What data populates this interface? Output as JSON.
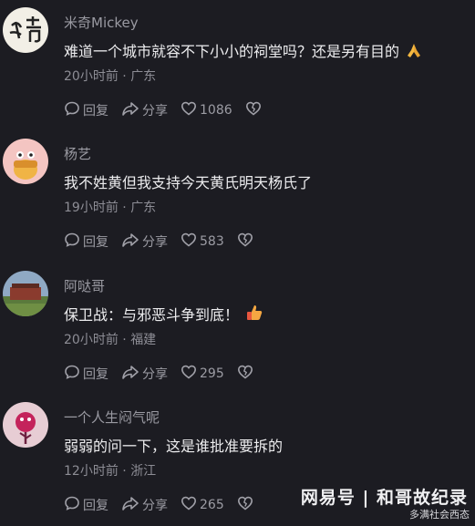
{
  "comments": [
    {
      "username": "米奇Mickey",
      "text": "难道一个城市就容不下小小的祠堂吗？还是另有目的",
      "emoji_icon": "praying-hands-icon",
      "time": "20小时前",
      "location": "广东",
      "reply_label": "回复",
      "share_label": "分享",
      "likes": "1086"
    },
    {
      "username": "杨艺",
      "text": "我不姓黄但我支持今天黄氏明天杨氏了",
      "time": "19小时前",
      "location": "广东",
      "reply_label": "回复",
      "share_label": "分享",
      "likes": "583"
    },
    {
      "username": "阿哒哥",
      "text": "保卫战：与邪恶斗争到底！",
      "emoji_icon": "thumbs-up-icon",
      "time": "20小时前",
      "location": "福建",
      "reply_label": "回复",
      "share_label": "分享",
      "likes": "295"
    },
    {
      "username": "一个人生闷气呢",
      "text": "弱弱的问一下，这是谁批准要拆的",
      "time": "12小时前",
      "location": "浙江",
      "reply_label": "回复",
      "share_label": "分享",
      "likes": "265"
    }
  ],
  "separator": " · ",
  "watermark": {
    "brand": "网易号 | 和哥故纪录",
    "sub": "多满社会西态"
  },
  "colors": {
    "background": "#1c1c22",
    "text": "#ececee",
    "muted": "#8d8d95"
  }
}
